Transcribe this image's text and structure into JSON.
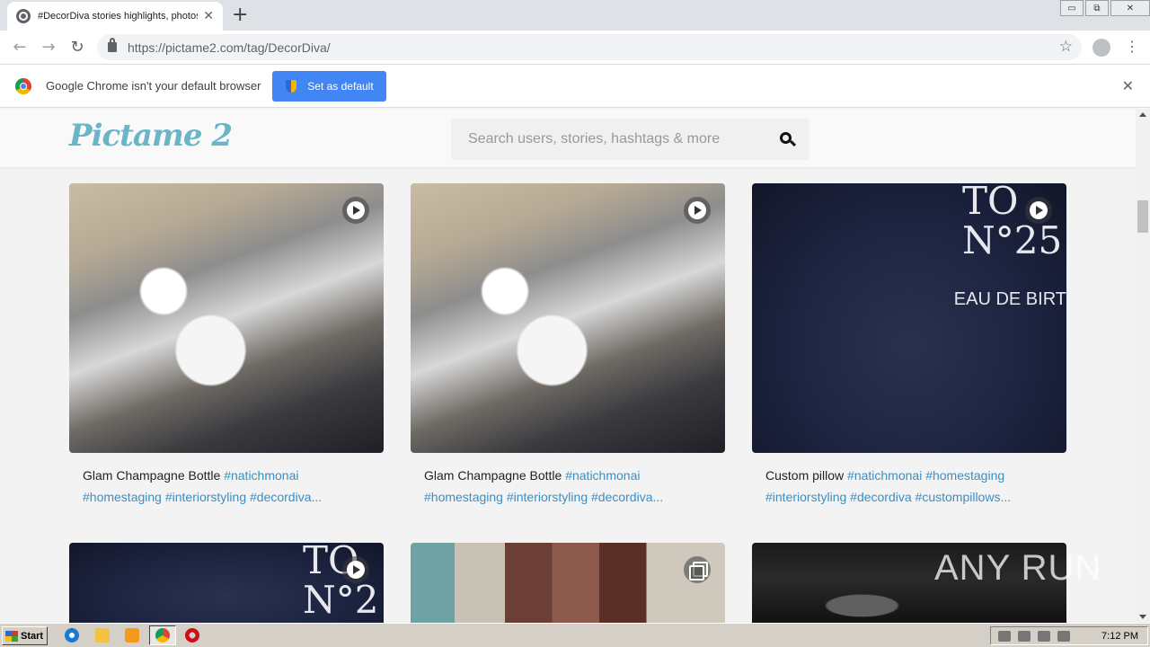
{
  "browser": {
    "tab_title": "#DecorDiva stories highlights, photos",
    "tab_close": "✕",
    "new_tab": "+",
    "url_host": "https://pictame2.com",
    "url_path": "/tag/DecorDiva/",
    "window_min": "▭",
    "window_max": "⧉",
    "window_close": "✕"
  },
  "infobar": {
    "message": "Google Chrome isn't your default browser",
    "button_label": "Set as default",
    "close": "✕"
  },
  "site": {
    "logo": "Pictame 2",
    "search_placeholder": "Search users, stories, hashtags & more"
  },
  "posts": [
    {
      "title": "Glam Champagne Bottle",
      "tags_line1": "#natichmonai",
      "tags_line2": "#homestaging #interiorstyling #decordiva...",
      "badge": "video",
      "image": "sparkle-bottle"
    },
    {
      "title": "Glam Champagne Bottle",
      "tags_line1": "#natichmonai",
      "tags_line2": "#homestaging #interiorstyling #decordiva...",
      "badge": "video",
      "image": "sparkle-bottle"
    },
    {
      "title": "Custom pillow",
      "tags_line1": "#natichmonai #homestaging",
      "tags_line2": "#interiorstyling #decordiva #custompillows...",
      "badge": "video",
      "image": "pillow",
      "image_text_1": "TO\nN°25",
      "image_text_2": "EAU DE BIRT"
    },
    {
      "badge": "video",
      "image": "pillow",
      "image_text_1": "TO\nN°2",
      "image_text_2": ""
    },
    {
      "badge": "carousel",
      "image": "willow"
    },
    {
      "badge": "none",
      "image": "glasses"
    }
  ],
  "watermark": "ANY RUN",
  "taskbar": {
    "start_label": "Start",
    "clock": "7:12 PM"
  },
  "colors": {
    "accent": "#4285f4",
    "logo": "#6bb5c9",
    "hashtag": "#3a8fc5"
  }
}
